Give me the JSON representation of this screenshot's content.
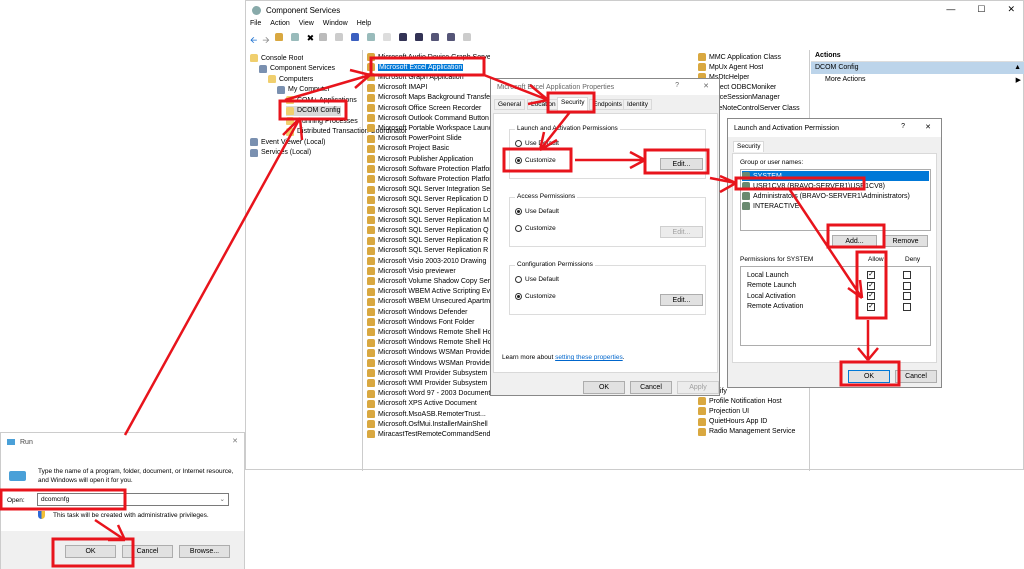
{
  "mmc": {
    "title": "Component Services",
    "menu": [
      "File",
      "Action",
      "View",
      "Window",
      "Help"
    ],
    "tree": [
      {
        "label": "Console Root"
      },
      {
        "label": "Component Services"
      },
      {
        "label": "Computers"
      },
      {
        "label": "My Computer"
      },
      {
        "label": "COM+ Applications"
      },
      {
        "label": "DCOM Config"
      },
      {
        "label": "Running Processes"
      },
      {
        "label": "Distributed Transaction Coordinator"
      },
      {
        "label": "Event Viewer (Local)"
      },
      {
        "label": "Services (Local)"
      }
    ],
    "list": [
      "Microsoft Audio Device Graph Server",
      "Microsoft Excel Application",
      "Microsoft Graph Application",
      "Microsoft IMAPI",
      "Microsoft Maps Background Transfer",
      "Microsoft Office Screen Recorder",
      "Microsoft Outlook Command Button",
      "Microsoft Portable Workspace Launcher",
      "Microsoft PowerPoint Slide",
      "Microsoft Project Basic",
      "Microsoft Publisher Application",
      "Microsoft Software Protection Platform",
      "Microsoft Software Protection Platform",
      "Microsoft SQL Server Integration Services",
      "Microsoft SQL Server Replication D",
      "Microsoft SQL Server Replication Lo",
      "Microsoft SQL Server Replication M",
      "Microsoft SQL Server Replication Q",
      "Microsoft SQL Server Replication R",
      "Microsoft SQL Server Replication R",
      "Microsoft Visio 2003-2010 Drawing",
      "Microsoft Visio previewer",
      "Microsoft Volume Shadow Copy Service",
      "Microsoft WBEM Active Scripting Event",
      "Microsoft WBEM Unsecured Apartment",
      "Microsoft Windows Defender",
      "Microsoft Windows Font Folder",
      "Microsoft Windows Remote Shell Host",
      "Microsoft Windows Remote Shell Host",
      "Microsoft Windows WSMan Provider",
      "Microsoft Windows WSMan Provider",
      "Microsoft WMI Provider Subsystem",
      "Microsoft WMI Provider Subsystem",
      "Microsoft Word 97 - 2003 Document",
      "Microsoft XPS Active Document",
      "Microsoft.MsoASB.RemoterTrust...",
      "Microsoft.OsfMui.InstallerMainShell",
      "MiracastTestRemoteCommandSend..."
    ],
    "list2_top": [
      "MMC Application Class",
      "MpUx Agent Host",
      "MsDtcHelper",
      "Object ODBCMoniker",
      "OfficeSessionManager",
      "OneNoteControlServer Class"
    ],
    "list2_bottom": [
      "Notify",
      "Profile Notification Host",
      "Projection UI",
      "QuietHours App ID",
      "Radio Management Service"
    ],
    "actions": {
      "header": "Actions",
      "section": "DCOM Config",
      "more": "More Actions"
    }
  },
  "props": {
    "title": "Microsoft Excel Application Properties",
    "tabs": [
      "General",
      "Location",
      "Security",
      "Endpoints",
      "Identity"
    ],
    "groups": [
      {
        "label": "Launch and Activation Permissions",
        "opt1": "Use Default",
        "opt2": "Customize",
        "edit": "Edit...",
        "selected": "Customize"
      },
      {
        "label": "Access Permissions",
        "opt1": "Use Default",
        "opt2": "Customize",
        "edit": "Edit...",
        "selected": "Use Default"
      },
      {
        "label": "Configuration Permissions",
        "opt1": "Use Default",
        "opt2": "Customize",
        "edit": "Edit...",
        "selected": "Customize"
      }
    ],
    "learn_prefix": "Learn more about ",
    "learn_link": "setting these properties",
    "learn_suffix": ".",
    "ok": "OK",
    "cancel": "Cancel",
    "apply": "Apply"
  },
  "perm": {
    "title": "Launch and Activation Permission",
    "tab": "Security",
    "group_label": "Group or user names:",
    "users": [
      "SYSTEM",
      "USR1CV8 (BRAVO-SERVER1\\USR1CV8)",
      "Administrators (BRAVO-SERVER1\\Administrators)",
      "INTERACTIVE"
    ],
    "add": "Add...",
    "remove": "Remove",
    "perm_label": "Permissions for SYSTEM",
    "allow": "Allow",
    "deny": "Deny",
    "perms": [
      {
        "name": "Local Launch",
        "allow": true,
        "deny": false
      },
      {
        "name": "Remote Launch",
        "allow": true,
        "deny": false
      },
      {
        "name": "Local Activation",
        "allow": true,
        "deny": false
      },
      {
        "name": "Remote Activation",
        "allow": true,
        "deny": false
      }
    ],
    "ok": "OK",
    "cancel": "Cancel"
  },
  "run": {
    "title": "Run",
    "desc": "Type the name of a program, folder, document, or Internet resource, and Windows will open it for you.",
    "open_label": "Open:",
    "value": "dcomcnfg",
    "admin_note": "This task will be created with administrative privileges.",
    "ok": "OK",
    "cancel": "Cancel",
    "browse": "Browse..."
  },
  "colors": {
    "annotation": "#e8141c",
    "selection": "#0078d7",
    "actions_header": "#bcd4ea"
  }
}
